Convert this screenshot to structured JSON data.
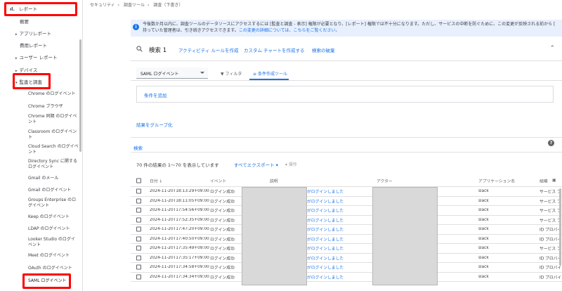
{
  "breadcrumb": [
    "セキュリティ",
    "調査ツール",
    "調査（下書き）"
  ],
  "sidebar": {
    "report": "レポート",
    "overview": "概要",
    "app_reports": "アプリレポート",
    "billing_reports": "費用レポート",
    "user_reports": "ユーザー レポート",
    "devices": "デバイス",
    "audit": "監査と調査",
    "sub_items": [
      "Chrome のログイベント",
      "Chrome ブラウザ",
      "Chrome 同期 のログイベント",
      "Classroom のログイベント",
      "Cloud Search のログイベント",
      "Directory Sync に関するログイベント",
      "Gmail のメール",
      "Gmail のログイベント",
      "Groups Enterprise のログイベント",
      "Keep のログイベント",
      "LDAP のログイベント",
      "Looker Studio のログイベント",
      "Meet のログイベント",
      "OAuth のログイベント",
      "SAML ログイベント"
    ]
  },
  "banner": {
    "line1": "今後数か月以内に、調査ツールのデータソースにアクセスするには [監査と調査 - 表示] 権限が必要となり、[レポート] 権限では不十分になります。ただし、サービスの中断を防ぐために、この変更が反映される前から [",
    "line2": "持っていた管理者は、引き続きアクセスできます。",
    "link": "この変更の詳細については、こちらをご覧ください。"
  },
  "search": {
    "title": "検索 1",
    "links": [
      "アクティビティ ルールを作成",
      "カスタム チャートを作成する",
      "検索の破棄"
    ]
  },
  "filter": {
    "source": "SAML ログイベント",
    "tab_filter": "フィルタ",
    "tab_builder": "条件作成ツール",
    "add_condition": "条件を追加",
    "group_results": "結果をグループ化",
    "search_button": "検索"
  },
  "results": {
    "count": "70 件の結果の 1〜70 を表示しています",
    "export_all": "すべてエクスポート",
    "operations": "操作"
  },
  "table": {
    "headers": [
      "日付",
      "イベント",
      "説明",
      "アクター",
      "アプリケーション名",
      "組織"
    ],
    "rows": [
      {
        "date": "2024-11-20T18:13:29+09:00",
        "event": "ログイン成功",
        "desc": "がログインしました",
        "app": "slack",
        "org": "サービス プ"
      },
      {
        "date": "2024-11-20T18:11:05+09:00",
        "event": "ログイン成功",
        "desc": "がログインしました",
        "app": "slack",
        "org": "サービス プ"
      },
      {
        "date": "2024-11-20T17:54:56+09:00",
        "event": "ログイン成功",
        "desc": "がログインしました",
        "app": "slack",
        "org": "サービス プ"
      },
      {
        "date": "2024-11-20T17:52:35+09:00",
        "event": "ログイン成功",
        "desc": "がログインしました",
        "app": "slack",
        "org": "サービス プ"
      },
      {
        "date": "2024-11-20T17:47:20+09:00",
        "event": "ログイン成功",
        "desc": "がログインしました",
        "app": "slack",
        "org": "ID プロバイ"
      },
      {
        "date": "2024-11-20T17:40:50+09:00",
        "event": "ログイン成功",
        "desc": "がログインしました",
        "app": "slack",
        "org": "ID プロバイ"
      },
      {
        "date": "2024-11-20T17:35:49+09:00",
        "event": "ログイン成功",
        "desc": "がログインしました",
        "app": "slack",
        "org": "サービス プ"
      },
      {
        "date": "2024-11-20T17:35:17+09:00",
        "event": "ログイン成功",
        "desc": "がログインしました",
        "app": "slack",
        "org": "ID プロバイ"
      },
      {
        "date": "2024-11-20T17:34:58+09:00",
        "event": "ログイン成功",
        "desc": "がログインしました",
        "app": "slack",
        "org": "ID プロバイ"
      },
      {
        "date": "2024-11-20T17:34:34+09:00",
        "event": "ログイン成功",
        "desc": "がログインしました",
        "app": "slack",
        "org": "ID プロバイ"
      }
    ]
  }
}
